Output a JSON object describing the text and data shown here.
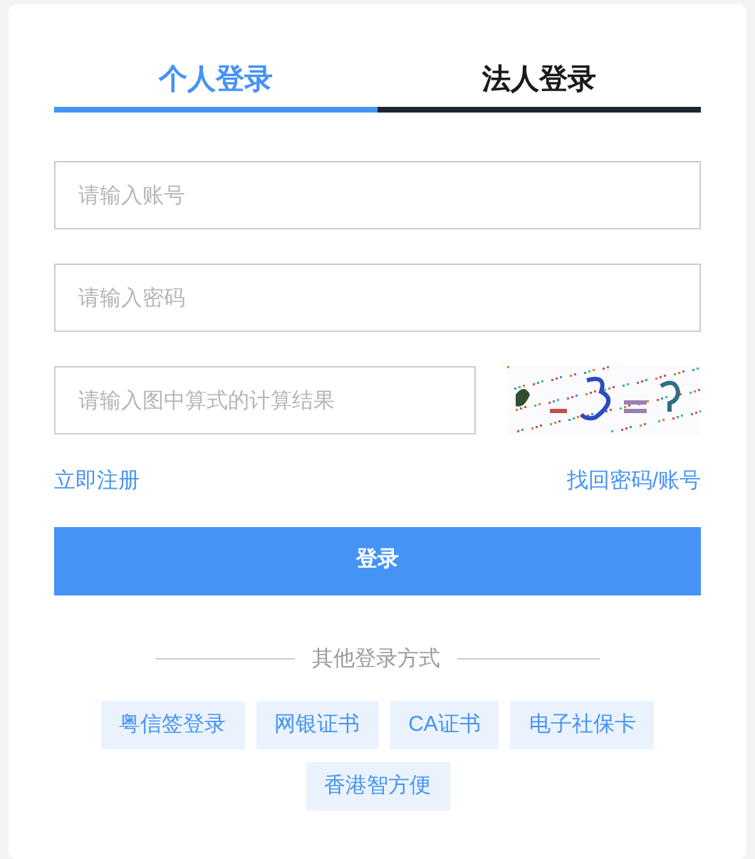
{
  "tabs": [
    {
      "label": "个人登录",
      "selected": true
    },
    {
      "label": "法人登录",
      "selected": false
    }
  ],
  "fields": [
    {
      "placeholder": "请输入账号"
    },
    {
      "placeholder": "请输入密码"
    }
  ],
  "captcha": {
    "placeholder": "请输入图中算式的计算结果",
    "kind": "picture"
  },
  "links": {
    "register": "立即注册",
    "recover": "找回密码/账号"
  },
  "login_button": "登录",
  "other_methods": {
    "title": "其他登录方式",
    "options": [
      "粤信签登录",
      "网银证书",
      "CA证书",
      "电子社保卡",
      "香港智方便"
    ]
  }
}
